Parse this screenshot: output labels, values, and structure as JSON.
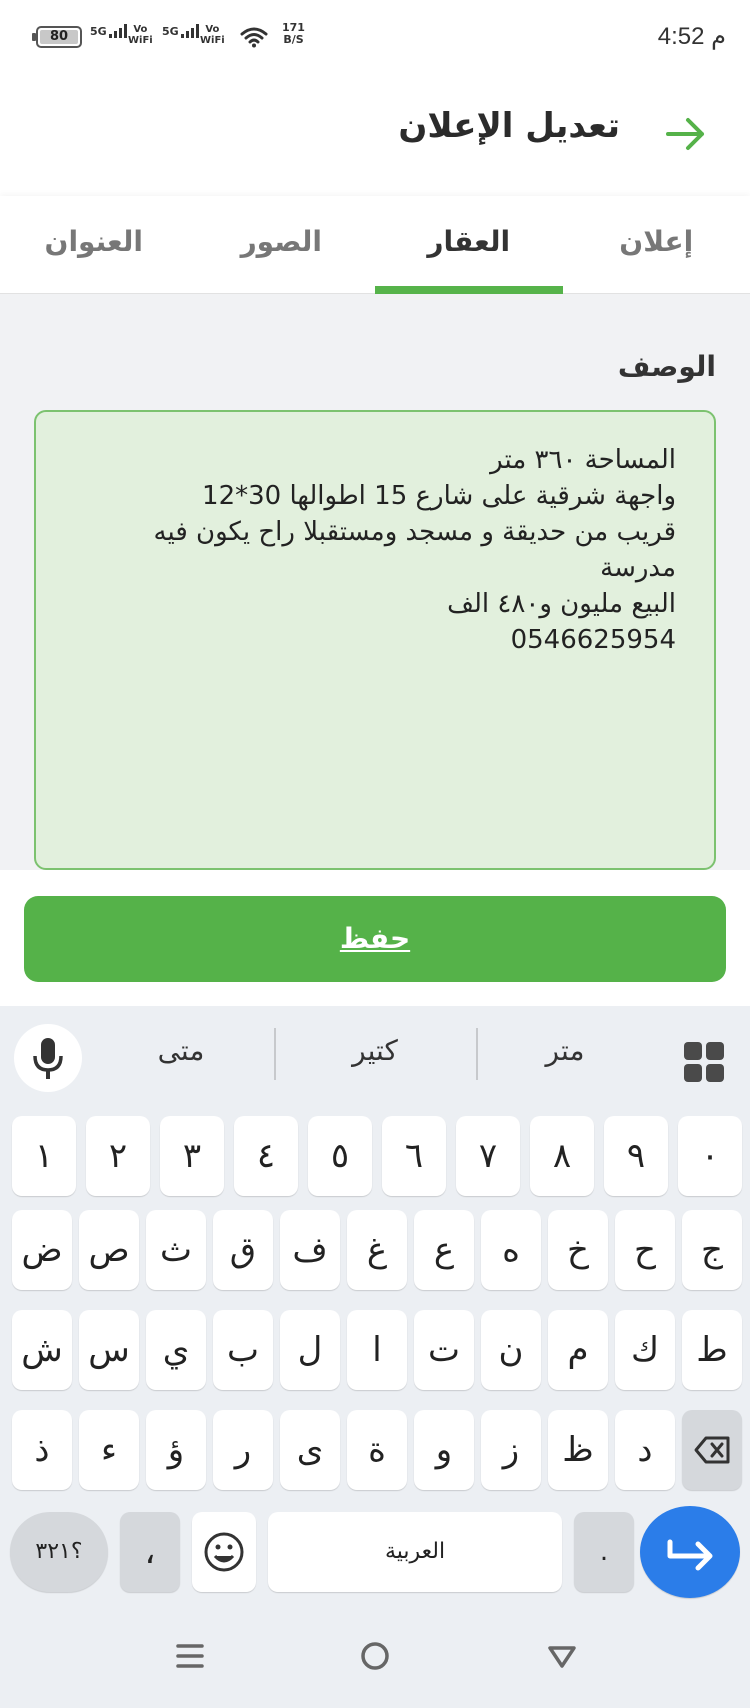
{
  "status_bar": {
    "battery": "80",
    "signal1_label": "5G",
    "vowifi1": [
      "Vo",
      "WiFi"
    ],
    "signal2_label": "5G",
    "vowifi2": [
      "Vo",
      "WiFi"
    ],
    "net_speed_value": "171",
    "net_speed_unit": "B/S",
    "time": "4:52 م"
  },
  "header": {
    "title": "تعديل الإعلان"
  },
  "tabs": [
    {
      "label": "إعلان",
      "active": false
    },
    {
      "label": "العقار",
      "active": true
    },
    {
      "label": "الصور",
      "active": false
    },
    {
      "label": "العنوان",
      "active": false
    }
  ],
  "form": {
    "description_label": "الوصف",
    "description_value": "المساحة ٣٦٠ متر\nواجهة شرقية على شارع 15 اطوالها 30*12\nقريب من حديقة و مسجد ومستقبلا راح يكون فيه مدرسة\nالبيع مليون و٤٨٠ الف\n0546625954"
  },
  "save_button": {
    "label": "حفظ"
  },
  "keyboard": {
    "suggestions": [
      "متر",
      "كتير",
      "متى"
    ],
    "row_digits": [
      "٠",
      "٩",
      "٨",
      "٧",
      "٦",
      "٥",
      "٤",
      "٣",
      "٢",
      "١"
    ],
    "row1": [
      "ج",
      "ح",
      "خ",
      "ه",
      "ع",
      "غ",
      "ف",
      "ق",
      "ث",
      "ص",
      "ض"
    ],
    "row2": [
      "ط",
      "ك",
      "م",
      "ن",
      "ت",
      "ا",
      "ل",
      "ب",
      "ي",
      "س",
      "ش"
    ],
    "row3": [
      "د",
      "ظ",
      "ز",
      "و",
      "ة",
      "ى",
      "ر",
      "ؤ",
      "ء",
      "ذ"
    ],
    "symbols_key": "؟٣٢١",
    "comma_key": "،",
    "space_label": "العربية",
    "period_key": ".",
    "colors": {
      "accent": "#55b249",
      "enter": "#2b7de9"
    }
  }
}
